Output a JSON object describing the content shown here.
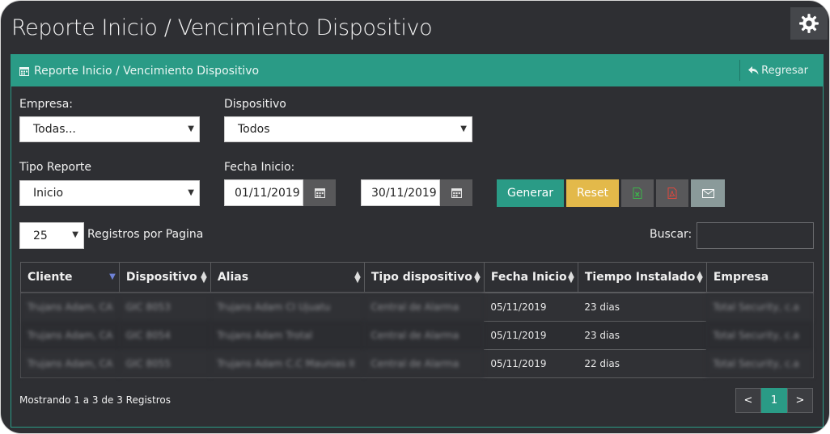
{
  "page": {
    "title": "Reporte Inicio / Vencimiento Dispositivo"
  },
  "panel": {
    "title": "Reporte Inicio / Vencimiento Dispositivo",
    "back_label": "Regresar"
  },
  "filters": {
    "empresa_label": "Empresa:",
    "empresa_value": "Todas...",
    "dispositivo_label": "Dispositivo",
    "dispositivo_value": "Todos",
    "tipo_label": "Tipo Reporte",
    "tipo_value": "Inicio",
    "fecha_label": "Fecha Inicio:",
    "fecha_desde": "01/11/2019",
    "fecha_hasta": "30/11/2019"
  },
  "actions": {
    "generar": "Generar",
    "reset": "Reset"
  },
  "table_controls": {
    "page_size": "25",
    "page_size_label": "Registros por Pagina",
    "search_label": "Buscar:"
  },
  "table": {
    "headers": [
      "Cliente",
      "Dispositivo",
      "Alias",
      "Tipo dispositivo",
      "Fecha Inicio",
      "Tiempo Instalado",
      "Empresa"
    ],
    "rows": [
      [
        "Trujans Adam, CA",
        "GIC 8053",
        "Trujans Adam CI Ujuatu",
        "Central de Alarma",
        "05/11/2019",
        "23 dias",
        "Total Security, c.a"
      ],
      [
        "Trujans Adam, CA",
        "GIC 8054",
        "Trujans Adam Trotal",
        "Central de Alarma",
        "05/11/2019",
        "23 dias",
        "Total Security, c.a"
      ],
      [
        "Trujans Adam, CA",
        "GIC 8055",
        "Trujans Adam C.C Maunias II",
        "Central de Alarma",
        "05/11/2019",
        "22 dias",
        "Total Security, c.a"
      ]
    ]
  },
  "footer": {
    "info": "Mostrando 1 a 3 de 3 Registros",
    "prev": "<",
    "current_page": "1",
    "next": ">"
  },
  "colors": {
    "accent": "#2a9b86",
    "reset": "#e3b94a",
    "background": "#2e2f33"
  },
  "icons": {
    "settings": "gear-icon",
    "header": "calendar-icon",
    "back": "reply-icon",
    "date": "calendar-icon",
    "excel": "file-excel-icon",
    "pdf": "file-pdf-icon",
    "email": "envelope-icon"
  }
}
